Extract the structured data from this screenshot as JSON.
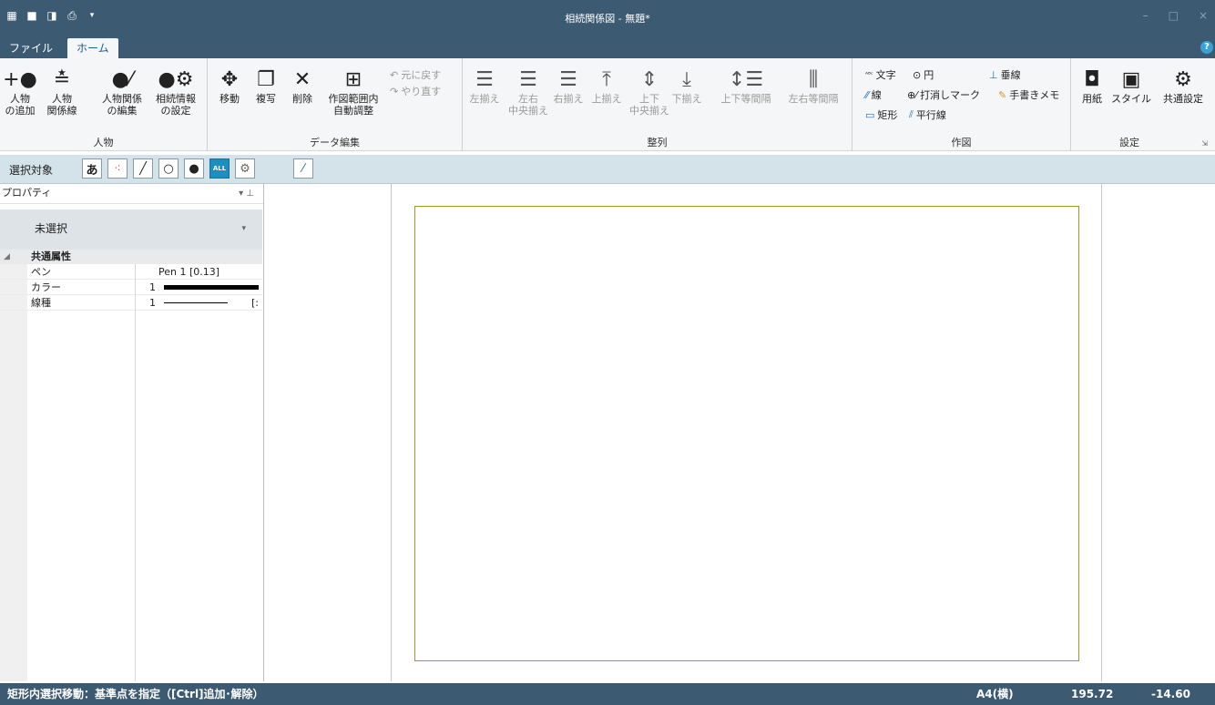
{
  "titlebar": {
    "title": "相続関係図 - 無題*"
  },
  "tabs": {
    "file": "ファイル",
    "home": "ホーム",
    "help": "?"
  },
  "ribbon": {
    "person": {
      "label": "人物",
      "add": [
        "人物",
        "の追加"
      ],
      "relation": [
        "人物",
        "関係線"
      ],
      "edit_relation": [
        "人物関係",
        "の編集"
      ],
      "inherit_settings": [
        "相続情報",
        "の設定"
      ]
    },
    "data_edit": {
      "label": "データ編集",
      "move": "移動",
      "copy": "複写",
      "delete": "削除",
      "autofit": [
        "作図範囲内",
        "自動調整"
      ],
      "undo": "元に戻す",
      "redo": "やり直す"
    },
    "align": {
      "label": "整列",
      "left": "左揃え",
      "hcenter": [
        "左右",
        "中央揃え"
      ],
      "right": "右揃え",
      "top": "上揃え",
      "vcenter": [
        "上下",
        "中央揃え"
      ],
      "bottom": "下揃え",
      "vspace": "上下等間隔",
      "hspace": "左右等間隔"
    },
    "draw": {
      "label": "作図",
      "text": "文字",
      "circle": "円",
      "vline": "垂線",
      "line": "線",
      "cancel_mark": "打消しマーク",
      "handwrite": "手書きメモ",
      "rect": "矩形",
      "parallel": "平行線"
    },
    "settings": {
      "label": "設定",
      "paper": "用紙",
      "style": "スタイル",
      "common": "共通設定"
    }
  },
  "selection_bar": {
    "label": "選択対象",
    "text_btn": "あ",
    "all_btn": "ALL"
  },
  "properties": {
    "header": "プロパティ",
    "header_ctl": "▾ ⊥",
    "selected": "未選択",
    "category": "共通属性",
    "rows": [
      {
        "name": "ペン",
        "value": "Pen 1 [0.13]"
      },
      {
        "name": "カラー",
        "value": "1"
      },
      {
        "name": "線種",
        "value": "1"
      }
    ],
    "line_type_suffix": "[:"
  },
  "status": {
    "message": "矩形内選択移動：基準点を指定（[Ctrl]追加･解除）",
    "paper": "A4(横)",
    "x": "195.72",
    "y": "-14.60"
  },
  "colors": {
    "chrome": "#3c5a72",
    "frame": "#9a9a2a",
    "accent": "#39a0d8"
  }
}
